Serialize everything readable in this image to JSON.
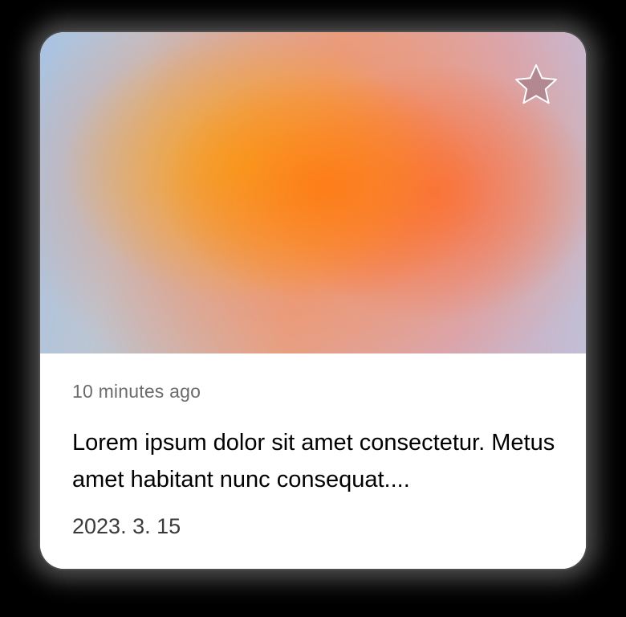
{
  "card": {
    "time_ago": "10 minutes ago",
    "headline": "Lorem ipsum dolor sit amet consectetur. Metus amet habitant nunc consequat....",
    "date": "2023. 3. 15",
    "favorite_icon": "star-outline-icon"
  },
  "colors": {
    "background": "#000000",
    "card": "#ffffff",
    "gradient_primary": "#ff8a1e",
    "gradient_edge": "#a9c3e2",
    "time_text": "#6b6b6b",
    "headline_text": "#000000",
    "date_text": "#3a3a3a"
  }
}
